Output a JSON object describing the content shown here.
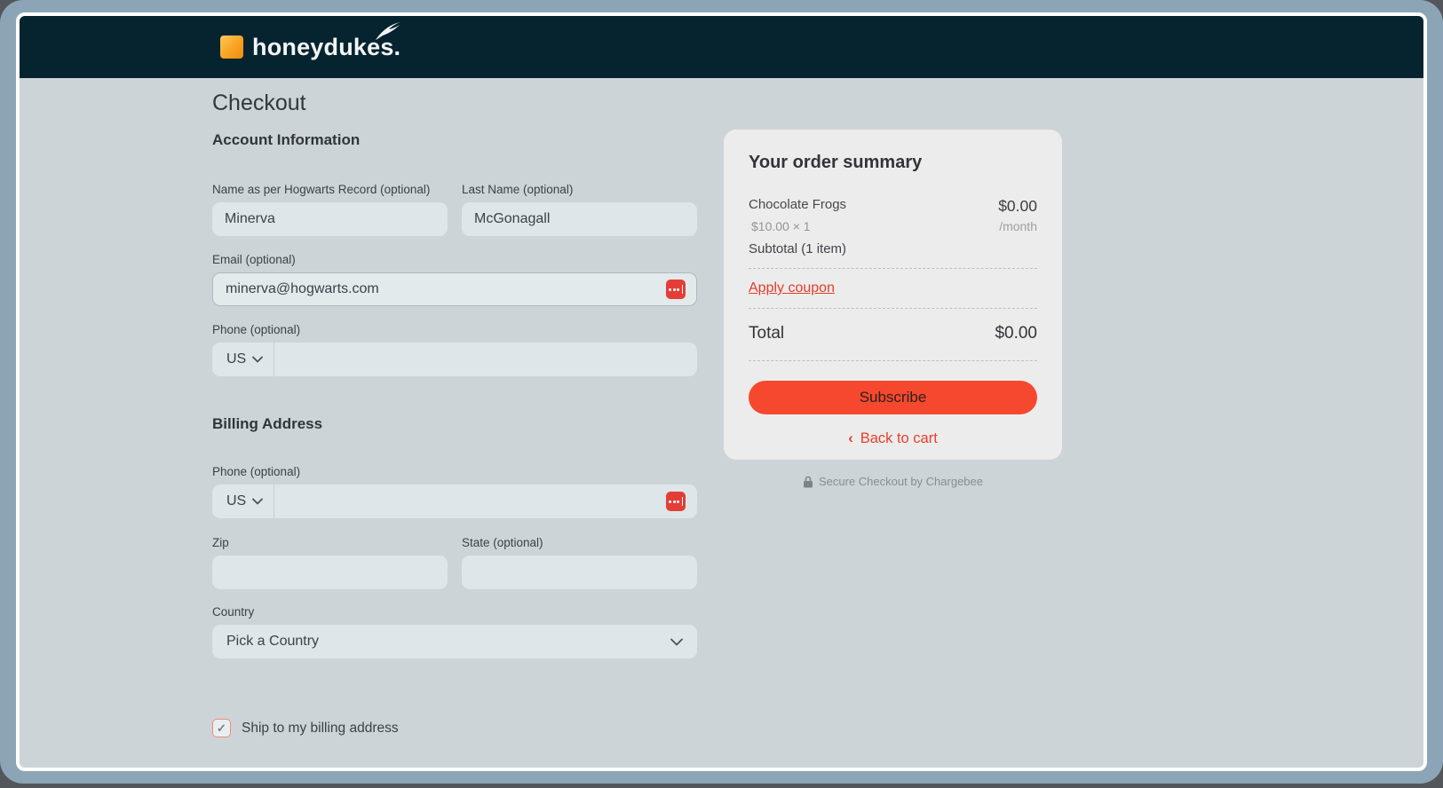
{
  "header": {
    "brand": "honeydukes.",
    "logo_icon": "orange-square",
    "quill_icon": "white-quill"
  },
  "page": {
    "title": "Checkout"
  },
  "account_section": {
    "heading": "Account Information",
    "first_name": {
      "label": "Name as per Hogwarts Record (optional)",
      "value": "Minerva"
    },
    "last_name": {
      "label": "Last Name (optional)",
      "value": "McGonagall"
    },
    "email": {
      "label": "Email (optional)",
      "value": "minerva@hogwarts.com"
    },
    "phone": {
      "label": "Phone (optional)",
      "country_code": "US",
      "value": ""
    }
  },
  "billing_section": {
    "heading": "Billing Address",
    "phone": {
      "label": "Phone (optional)",
      "country_code": "US",
      "value": ""
    },
    "zip": {
      "label": "Zip",
      "value": ""
    },
    "state": {
      "label": "State (optional)",
      "value": ""
    },
    "country": {
      "label": "Country",
      "selected": "Pick a Country"
    },
    "ship_checkbox": {
      "label": "Ship to my billing address",
      "checked": true,
      "check_glyph": "✓"
    }
  },
  "order_summary": {
    "title": "Your order summary",
    "items": [
      {
        "name": "Chocolate Frogs",
        "unit_line": "$10.00 × 1",
        "amount": "$0.00",
        "period": "/month"
      }
    ],
    "subtotal_label": "Subtotal (1 item)",
    "apply_coupon_label": "Apply coupon",
    "total_label": "Total",
    "total_value": "$0.00",
    "subscribe_label": "Subscribe",
    "back_chevron": "‹",
    "back_label": "Back to cart"
  },
  "footer": {
    "secure_text": "Secure Checkout by Chargebee"
  },
  "colors": {
    "accent_red": "#f6482f",
    "header_bg": "#06242f",
    "frame": "#8ba5b6",
    "content_bg": "#cdd4d7",
    "panel_bg": "#edecec"
  }
}
